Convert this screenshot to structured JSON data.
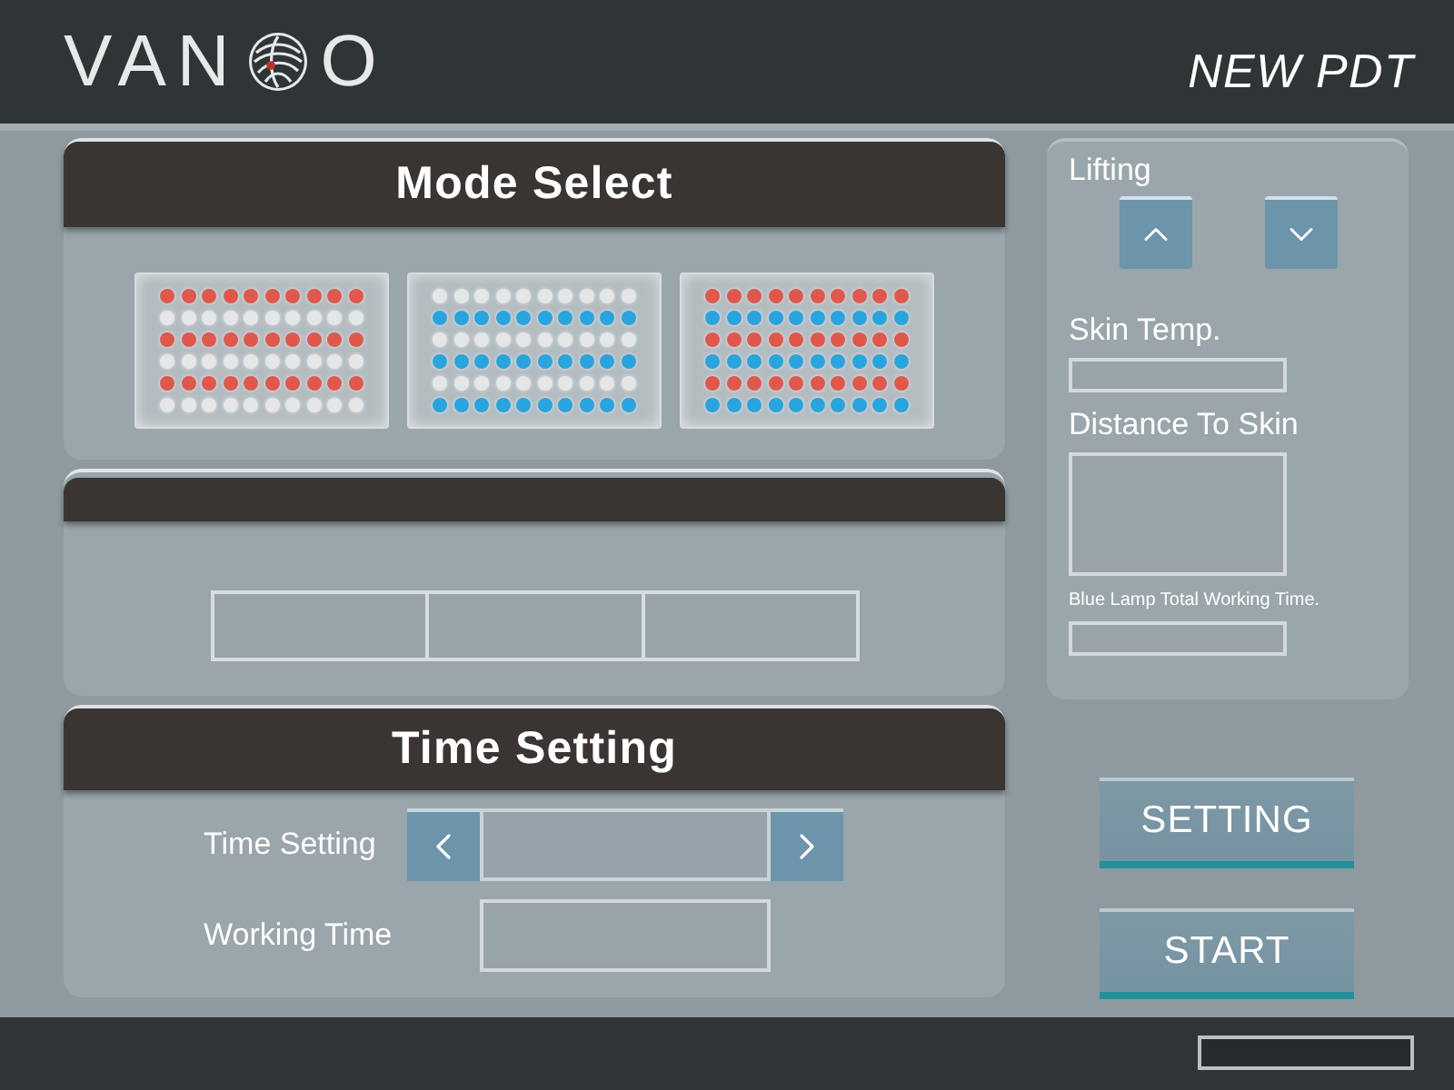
{
  "header": {
    "logo": {
      "left": "VAN",
      "right": "O"
    },
    "title": "NEW PDT"
  },
  "mode_select": {
    "title": "Mode Select",
    "modes": [
      {
        "rows": [
          {
            "color": "#e0574b"
          },
          {
            "color": "#e4e6e7"
          },
          {
            "color": "#e0574b"
          },
          {
            "color": "#e4e6e7"
          },
          {
            "color": "#e0574b"
          },
          {
            "color": "#e4e6e7"
          }
        ]
      },
      {
        "rows": [
          {
            "color": "#e4e6e7"
          },
          {
            "color": "#28a4de"
          },
          {
            "color": "#e4e6e7"
          },
          {
            "color": "#28a4de"
          },
          {
            "color": "#e4e6e7"
          },
          {
            "color": "#28a4de"
          }
        ]
      },
      {
        "rows": [
          {
            "color": "#e0574b"
          },
          {
            "color": "#28a4de"
          },
          {
            "color": "#e0574b"
          },
          {
            "color": "#28a4de"
          },
          {
            "color": "#e0574b"
          },
          {
            "color": "#28a4de"
          }
        ]
      }
    ]
  },
  "time_setting": {
    "title": "Time Setting",
    "rows": [
      {
        "kind": "stepper",
        "label": "Time Setting"
      },
      {
        "kind": "field",
        "label": "Working Time"
      }
    ]
  },
  "side_panel": {
    "lifting": {
      "label": "Lifting"
    },
    "readouts": [
      {
        "kind": "short",
        "label": "Skin Temp."
      },
      {
        "kind": "tall",
        "label": "Distance To Skin"
      },
      {
        "kind": "note",
        "label": "Blue Lamp Total Working Time."
      }
    ]
  },
  "actions": [
    "SETTING",
    "START"
  ]
}
